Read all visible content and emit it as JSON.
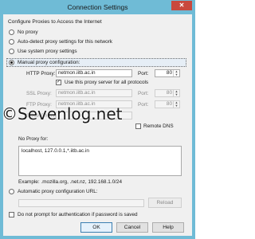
{
  "window": {
    "title": "Connection Settings",
    "close_glyph": "✕"
  },
  "header": "Configure Proxies to Access the Internet",
  "modes": {
    "no_proxy": "No proxy",
    "auto_detect": "Auto-detect proxy settings for this network",
    "system": "Use system proxy settings",
    "manual": "Manual proxy configuration:"
  },
  "http": {
    "label": "HTTP Proxy:",
    "value": "netmon.iitb.ac.in",
    "port_label": "Port:",
    "port": "80"
  },
  "use_for_all": "Use this proxy server for all protocols",
  "ssl": {
    "label": "SSL Proxy:",
    "value": "netmon.iitb.ac.in",
    "port_label": "Port:",
    "port": "80"
  },
  "ftp": {
    "label": "FTP Proxy:",
    "value": "netmon.iitb.ac.in",
    "port_label": "Port:",
    "port": "80"
  },
  "socks": {
    "label": "SOCKS Host:",
    "remote_dns": "Remote DNS"
  },
  "no_proxy_for": {
    "label": "No Proxy for:",
    "value": "localhost, 127.0.0.1,*.iitb.ac.in"
  },
  "example": "Example: .mozilla.org, .net.nz, 192.168.1.0/24",
  "auto_url": {
    "label": "Automatic proxy configuration URL:",
    "reload": "Reload"
  },
  "no_prompt": "Do not prompt for authentication if password is saved",
  "buttons": {
    "ok": "OK",
    "cancel": "Cancel",
    "help": "Help"
  },
  "watermark": "©Sevenlog.net",
  "colors": {
    "titlebar": "#6fbbd6",
    "client": "#f0f0f0",
    "close": "#c9483d"
  }
}
